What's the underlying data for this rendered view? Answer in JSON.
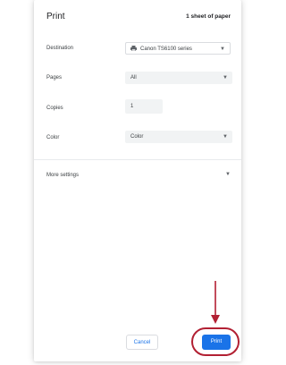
{
  "dialog": {
    "title": "Print",
    "sheet_count": "1 sheet of paper"
  },
  "settings": {
    "destination": {
      "label": "Destination",
      "value": "Canon TS6100 series"
    },
    "pages": {
      "label": "Pages",
      "value": "All"
    },
    "copies": {
      "label": "Copies",
      "value": "1"
    },
    "color": {
      "label": "Color",
      "value": "Color"
    }
  },
  "more_settings": {
    "label": "More settings"
  },
  "footer": {
    "cancel_label": "Cancel",
    "print_label": "Print"
  },
  "icons": {
    "printer": "printer-icon",
    "dropdown": "chevron-down-icon",
    "arrow": "arrow-down-icon"
  },
  "colors": {
    "accent": "#1a73e8",
    "highlight": "#b22033"
  }
}
